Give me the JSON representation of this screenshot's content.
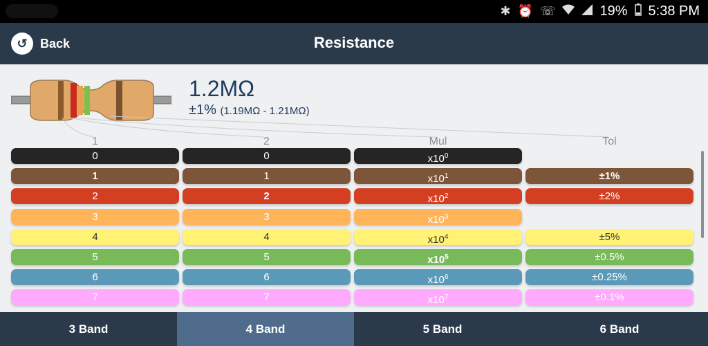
{
  "status": {
    "battery": "19%",
    "time": "5:38 PM",
    "icons": [
      "bluetooth-icon",
      "alarm-icon",
      "wifi-call-icon",
      "wifi-icon",
      "signal-icon",
      "battery-icon"
    ]
  },
  "header": {
    "back_label": "Back",
    "title": "Resistance"
  },
  "result": {
    "value": "1.2MΩ",
    "tolerance": "±1%",
    "range": "(1.19MΩ - 1.21MΩ)"
  },
  "resistor": {
    "bands": [
      "#8b5a2b",
      "#cc2a1e",
      "#e8a050",
      "#7cc050",
      "#7a5230"
    ]
  },
  "columns": {
    "headers": [
      "1",
      "2",
      "Mul",
      "Tol"
    ],
    "band1": [
      {
        "label": "0",
        "bg": "#252525",
        "fg": "#ffffff",
        "sel": false
      },
      {
        "label": "1",
        "bg": "#7d5538",
        "fg": "#ffffff",
        "sel": true
      },
      {
        "label": "2",
        "bg": "#d43f22",
        "fg": "#ffffff",
        "sel": false
      },
      {
        "label": "3",
        "bg": "#ffb45a",
        "fg": "#ffffff",
        "sel": false
      },
      {
        "label": "4",
        "bg": "#fff275",
        "fg": "#333333",
        "sel": false
      },
      {
        "label": "5",
        "bg": "#78b95a",
        "fg": "#ffffff",
        "sel": false
      },
      {
        "label": "6",
        "bg": "#5a9ab8",
        "fg": "#ffffff",
        "sel": false
      },
      {
        "label": "7",
        "bg": "#ffaaff",
        "fg": "#ffffff",
        "sel": false
      }
    ],
    "band2": [
      {
        "label": "0",
        "bg": "#252525",
        "fg": "#ffffff",
        "sel": false
      },
      {
        "label": "1",
        "bg": "#7d5538",
        "fg": "#ffffff",
        "sel": false
      },
      {
        "label": "2",
        "bg": "#d43f22",
        "fg": "#ffffff",
        "sel": true
      },
      {
        "label": "3",
        "bg": "#ffb45a",
        "fg": "#ffffff",
        "sel": false
      },
      {
        "label": "4",
        "bg": "#fff275",
        "fg": "#333333",
        "sel": false
      },
      {
        "label": "5",
        "bg": "#78b95a",
        "fg": "#ffffff",
        "sel": false
      },
      {
        "label": "6",
        "bg": "#5a9ab8",
        "fg": "#ffffff",
        "sel": false
      },
      {
        "label": "7",
        "bg": "#ffaaff",
        "fg": "#ffffff",
        "sel": false
      }
    ],
    "multiplier": [
      {
        "base": "x10",
        "exp": "0",
        "bg": "#252525",
        "fg": "#ffffff",
        "sel": false
      },
      {
        "base": "x10",
        "exp": "1",
        "bg": "#7d5538",
        "fg": "#ffffff",
        "sel": false
      },
      {
        "base": "x10",
        "exp": "2",
        "bg": "#d43f22",
        "fg": "#ffffff",
        "sel": false
      },
      {
        "base": "x10",
        "exp": "3",
        "bg": "#ffb45a",
        "fg": "#ffffff",
        "sel": false
      },
      {
        "base": "x10",
        "exp": "4",
        "bg": "#fff275",
        "fg": "#333333",
        "sel": false
      },
      {
        "base": "x10",
        "exp": "5",
        "bg": "#78b95a",
        "fg": "#ffffff",
        "sel": true
      },
      {
        "base": "x10",
        "exp": "6",
        "bg": "#5a9ab8",
        "fg": "#ffffff",
        "sel": false
      },
      {
        "base": "x10",
        "exp": "7",
        "bg": "#ffaaff",
        "fg": "#ffffff",
        "sel": false
      }
    ],
    "tolerance": [
      {
        "label": "±1%",
        "bg": "#7d5538",
        "fg": "#ffffff",
        "sel": true,
        "row": 1
      },
      {
        "label": "±2%",
        "bg": "#d43f22",
        "fg": "#ffffff",
        "sel": false,
        "row": 2
      },
      {
        "label": "±5%",
        "bg": "#fff275",
        "fg": "#333333",
        "sel": false,
        "row": 4
      },
      {
        "label": "±0.5%",
        "bg": "#78b95a",
        "fg": "#ffffff",
        "sel": false,
        "row": 5
      },
      {
        "label": "±0.25%",
        "bg": "#5a9ab8",
        "fg": "#ffffff",
        "sel": false,
        "row": 6
      },
      {
        "label": "±0.1%",
        "bg": "#ffaaff",
        "fg": "#ffffff",
        "sel": false,
        "row": 7
      }
    ]
  },
  "tabs": [
    {
      "label": "3 Band",
      "active": false
    },
    {
      "label": "4 Band",
      "active": true
    },
    {
      "label": "5 Band",
      "active": false
    },
    {
      "label": "6 Band",
      "active": false
    }
  ]
}
